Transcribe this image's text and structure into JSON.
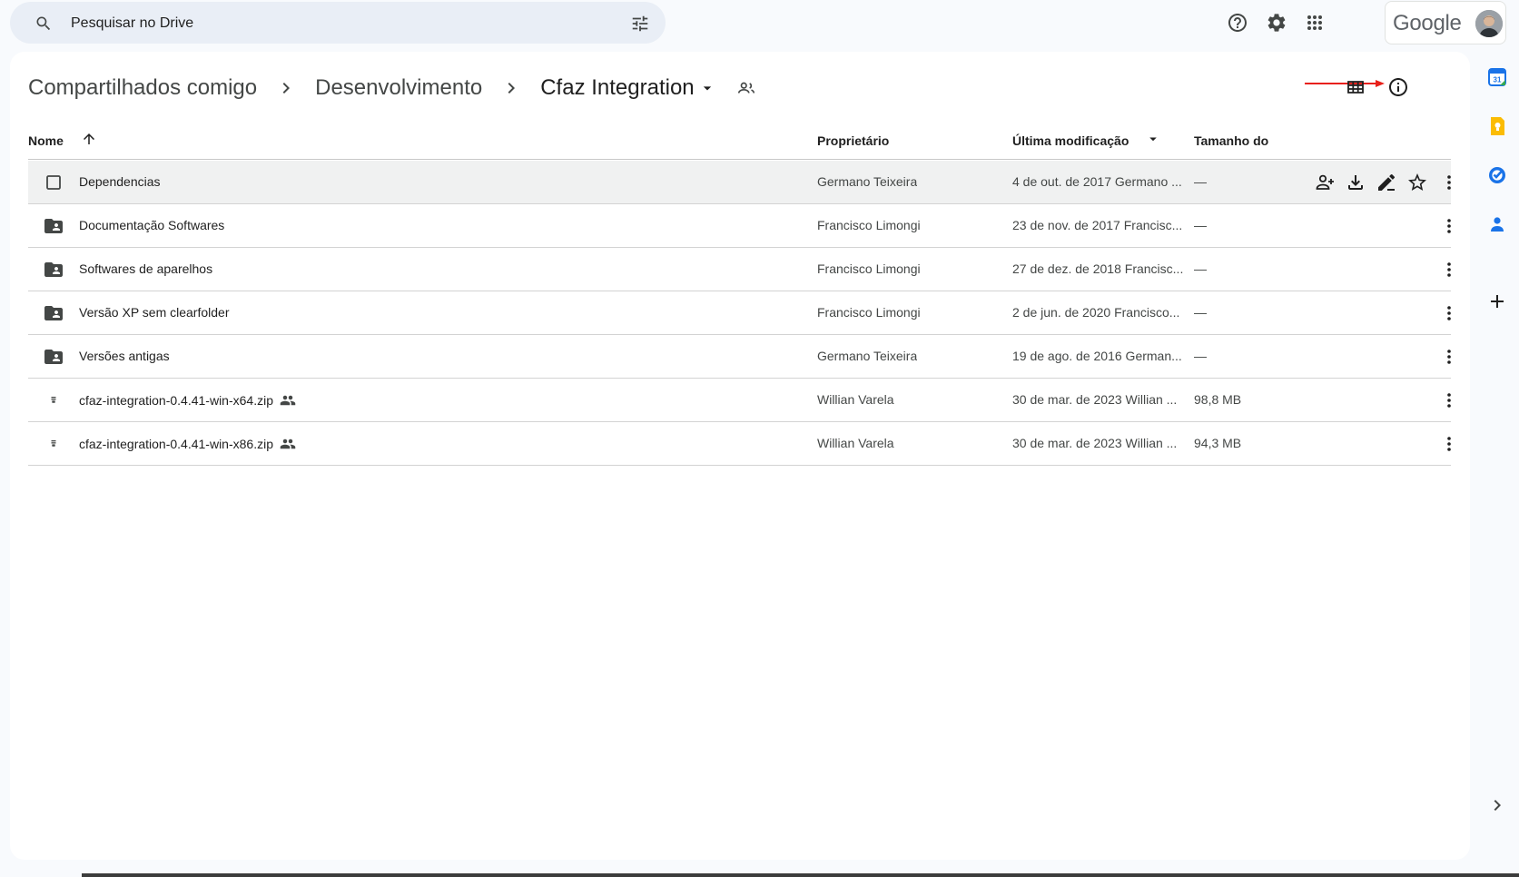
{
  "search": {
    "placeholder": "Pesquisar no Drive"
  },
  "account": {
    "logo_text": "Google"
  },
  "topbar_icons": [
    "help-icon",
    "settings-icon",
    "apps-grid-icon"
  ],
  "breadcrumb": {
    "items": [
      "Compartilhados comigo",
      "Desenvolvimento",
      "Cfaz Integration"
    ]
  },
  "table": {
    "headers": {
      "name": "Nome",
      "owner": "Proprietário",
      "modified": "Última modificação",
      "size": "Tamanho do"
    },
    "rows": [
      {
        "name": "Dependencias",
        "owner": "Germano Teixeira",
        "modified": "4 de out. de 2017 Germano ...",
        "size": "—",
        "type": "checkbox",
        "shared": false
      },
      {
        "name": "Documentação Softwares",
        "owner": "Francisco Limongi",
        "modified": "23 de nov. de 2017 Francisc...",
        "size": "—",
        "type": "shared-folder",
        "shared": false
      },
      {
        "name": "Softwares de aparelhos",
        "owner": "Francisco Limongi",
        "modified": "27 de dez. de 2018 Francisc...",
        "size": "—",
        "type": "shared-folder",
        "shared": false
      },
      {
        "name": "Versão XP sem clearfolder",
        "owner": "Francisco Limongi",
        "modified": "2 de jun. de 2020 Francisco...",
        "size": "—",
        "type": "shared-folder",
        "shared": false
      },
      {
        "name": "Versões antigas",
        "owner": "Germano Teixeira",
        "modified": "19 de ago. de 2016 German...",
        "size": "—",
        "type": "shared-folder",
        "shared": false
      },
      {
        "name": "cfaz-integration-0.4.41-win-x64.zip",
        "owner": "Willian Varela",
        "modified": "30 de mar. de 2023 Willian ...",
        "size": "98,8 MB",
        "type": "zip",
        "shared": true
      },
      {
        "name": "cfaz-integration-0.4.41-win-x86.zip",
        "owner": "Willian Varela",
        "modified": "30 de mar. de 2023 Willian ...",
        "size": "94,3 MB",
        "type": "zip",
        "shared": true
      }
    ]
  },
  "colors": {
    "annotation_arrow": "#e8201a",
    "calendar": "#1a73e8",
    "keep": "#fbbc04",
    "tasks": "#1a73e8",
    "contacts": "#1a73e8"
  }
}
